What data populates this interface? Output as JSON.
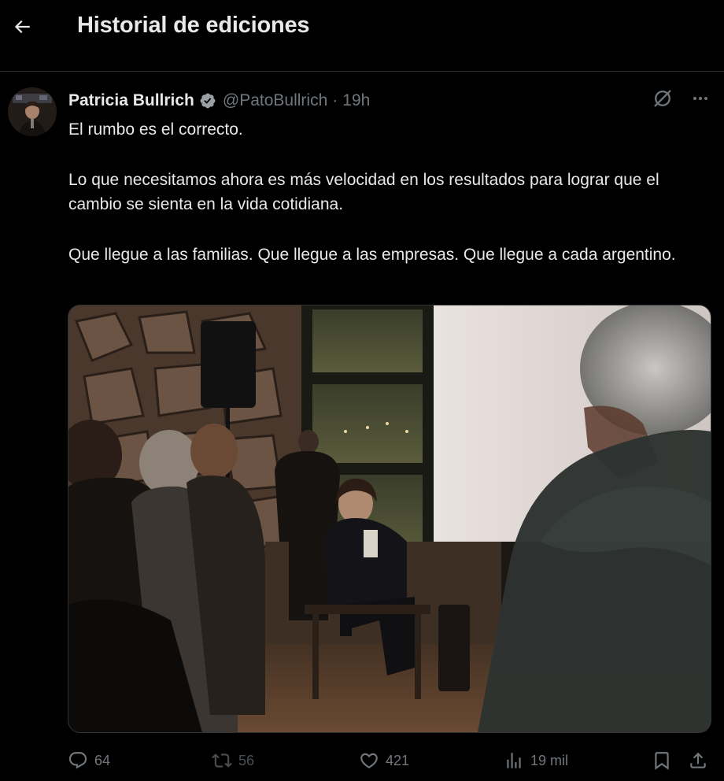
{
  "header": {
    "title": "Historial de ediciones",
    "back_icon": "arrow-left-icon"
  },
  "tweet": {
    "author": {
      "name": "Patricia Bullrich",
      "handle": "@PatoBullrich",
      "verified": true,
      "time": "19h"
    },
    "paragraphs": [
      "El rumbo es el correcto.",
      "Lo que necesitamos ahora es más velocidad en los resultados para lograr que el cambio se sienta en la vida cotidiana.",
      "Que llegue a las familias. Que llegue a las empresas. Que llegue a cada argentino."
    ],
    "separator": "·",
    "metrics": {
      "replies": "64",
      "retweets": "56",
      "likes": "421",
      "views": "19 mil"
    }
  },
  "colors": {
    "background": "#000000",
    "text": "#e7e9ea",
    "muted": "#71767b",
    "verified": "#1d9bf0",
    "border": "#2f3336"
  }
}
